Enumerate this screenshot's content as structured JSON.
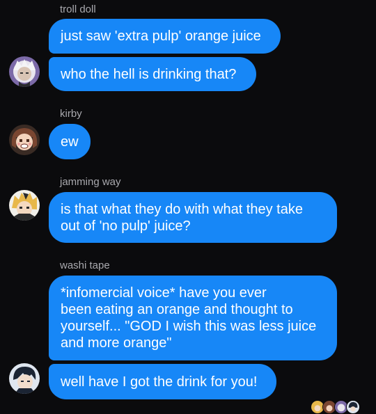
{
  "messages": [
    {
      "sender": "troll doll",
      "bubbles": [
        "just saw 'extra pulp' orange juice",
        "who the hell is drinking that?"
      ]
    },
    {
      "sender": "kirby",
      "bubbles": [
        "ew"
      ]
    },
    {
      "sender": "jamming way",
      "bubbles": [
        "is that what they do with what they take\nout of 'no pulp' juice?"
      ]
    },
    {
      "sender": "washi tape",
      "bubbles": [
        "*infomercial voice* have you ever\nbeen eating an orange and thought to\nyourself... \"GOD I wish this was less juice\nand more orange\"",
        "well have I got the drink for you!"
      ]
    }
  ],
  "avatars": {
    "troll_doll": "white-haired-character-avatar",
    "kirby": "brown-haired-character-avatar",
    "jamming_way": "blonde-character-avatar",
    "washi_tape": "dark-haired-character-avatar"
  },
  "colors": {
    "bubble": "#1787f7",
    "background": "#0b0b0d",
    "name_text": "#a9a9ae"
  }
}
